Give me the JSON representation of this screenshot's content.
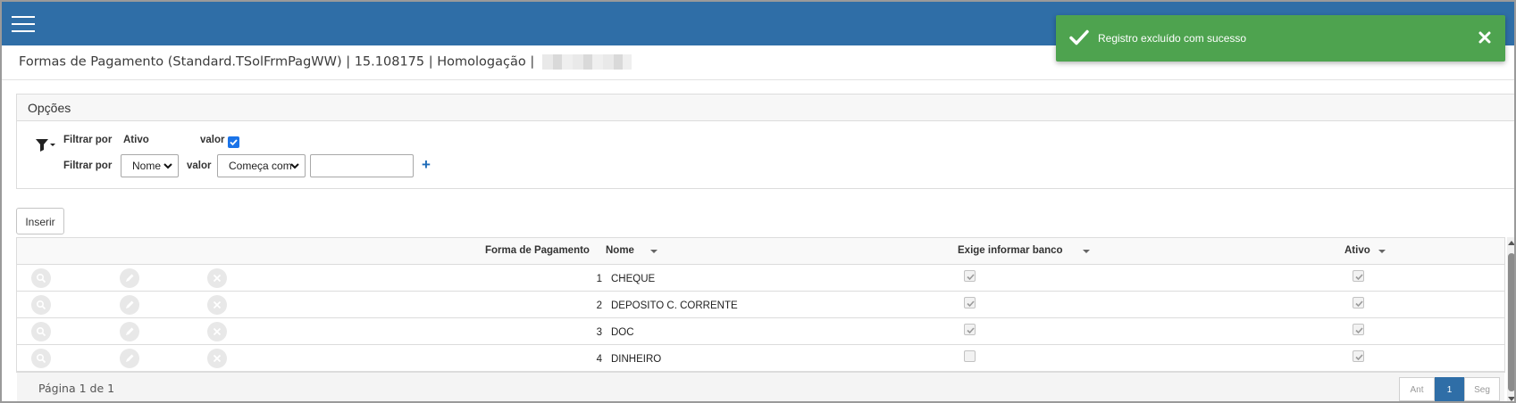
{
  "header": {
    "menu_icon": "hamburger-menu-icon"
  },
  "title": {
    "text": "Formas de Pagamento (Standard.TSolFrmPagWW) | 15.108175 | Homologação |"
  },
  "toast": {
    "message": "Registro excluído com sucesso",
    "icon": "check-icon",
    "close_icon": "close-icon",
    "color": "#4ea34f"
  },
  "options": {
    "title": "Opções",
    "filter_icon": "filter-icon",
    "filter1": {
      "label": "Filtrar por",
      "field": "Ativo",
      "value_label": "valor",
      "checked": true
    },
    "filter2": {
      "label": "Filtrar por",
      "field": "Nome",
      "value_label": "valor",
      "operator": "Começa com",
      "value": ""
    }
  },
  "insert_button": "Inserir",
  "grid": {
    "columns": {
      "forma": "Forma de Pagamento",
      "nome": "Nome",
      "banco": "Exige informar banco",
      "ativo": "Ativo"
    },
    "rows": [
      {
        "id": "1",
        "name": "CHEQUE",
        "exige_banco": true,
        "ativo": true
      },
      {
        "id": "2",
        "name": "DEPOSITO C. CORRENTE",
        "exige_banco": true,
        "ativo": true
      },
      {
        "id": "3",
        "name": "DOC",
        "exige_banco": true,
        "ativo": true
      },
      {
        "id": "4",
        "name": "DINHEIRO",
        "exige_banco": false,
        "ativo": true
      }
    ]
  },
  "pager": {
    "text": "Página 1 de 1",
    "prev": "Ant",
    "current": "1",
    "next": "Seg"
  },
  "colors": {
    "topbar": "#2f6ea7",
    "accent": "#1a73e8",
    "toast": "#4ea34f"
  }
}
